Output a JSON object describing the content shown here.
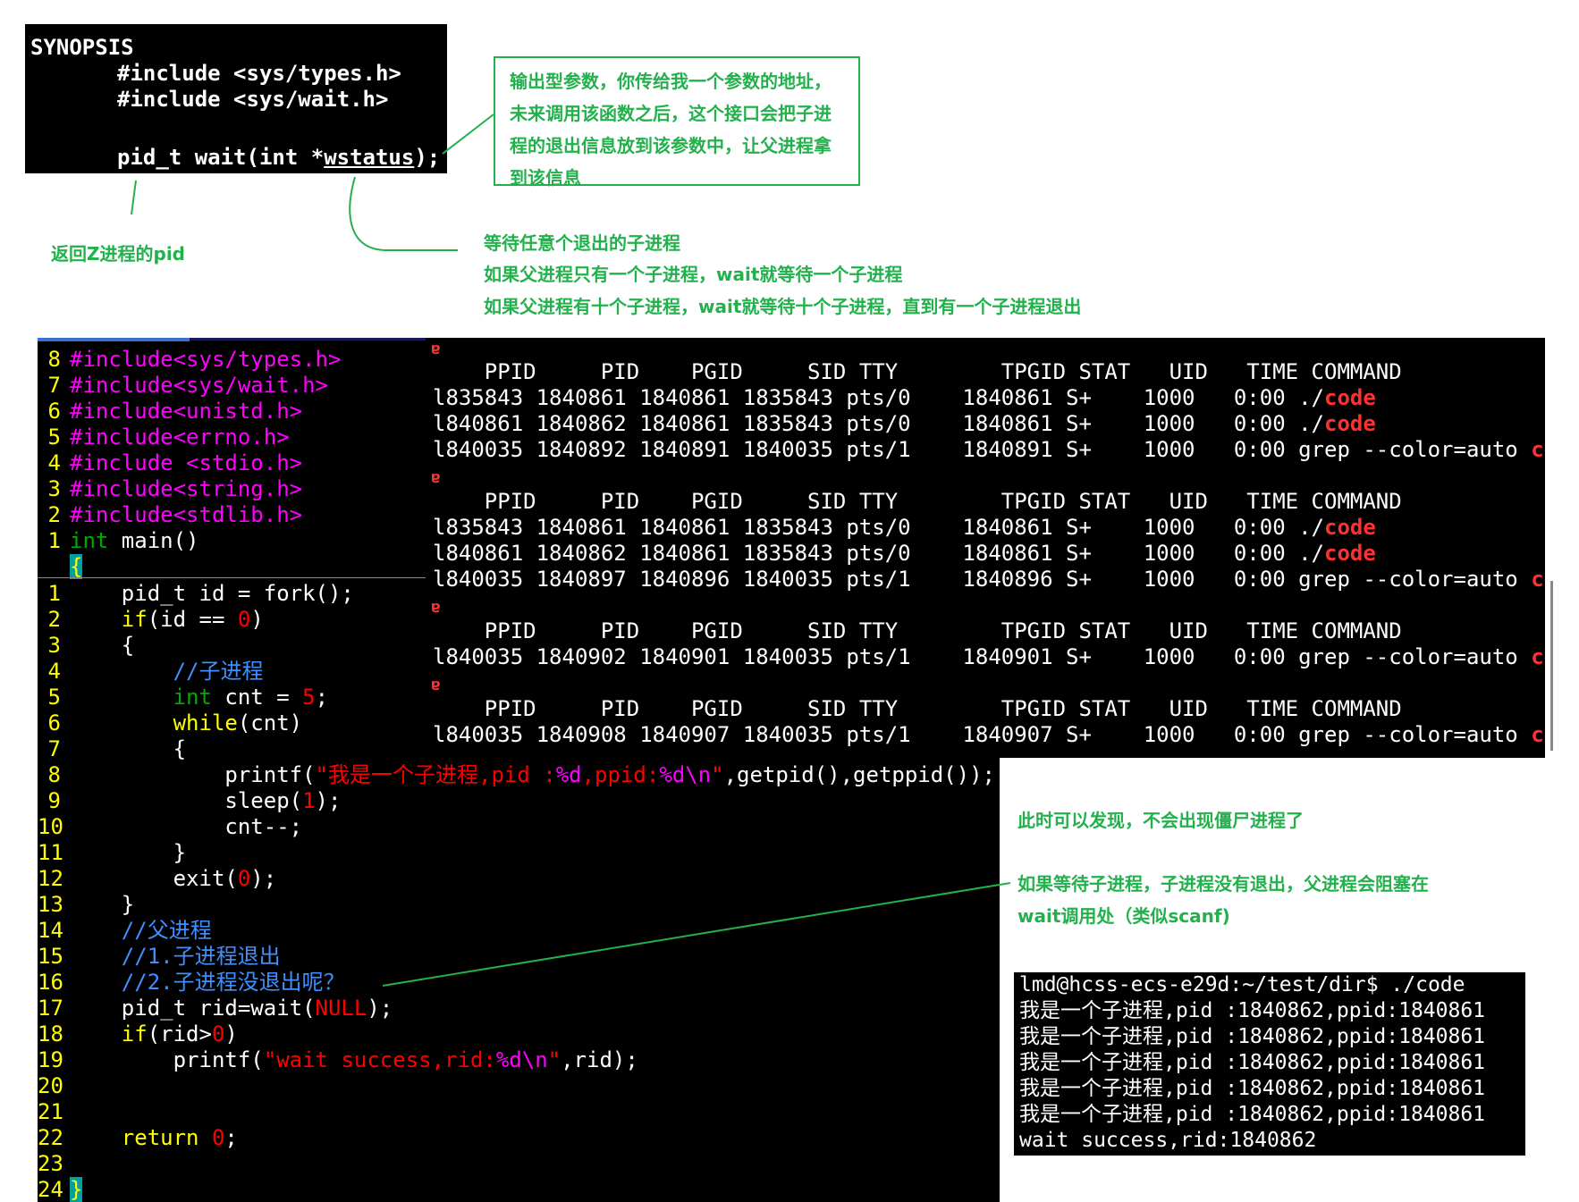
{
  "synopsis": {
    "heading": "SYNOPSIS",
    "include1": "#include <sys/types.h>",
    "include2": "#include <sys/wait.h>",
    "sig_prefix": "pid_t wait(int *",
    "sig_param": "wstatus",
    "sig_suffix": ");"
  },
  "annotations": {
    "output_param": [
      "输出型参数，你传给我一个参数的地址，",
      "未来调用该函数之后，这个接口会把子进",
      "程的退出信息放到该参数中，让父进程拿",
      "到该信息"
    ],
    "return_note": "返回Z进程的pid",
    "wait_any": [
      "等待任意个退出的子进程",
      "如果父进程只有一个子进程，wait就等待一个子进程",
      "如果父进程有十个子进程，wait就等待十个子进程，直到有一个子进程退出"
    ],
    "no_zombie": "此时可以发现，不会出现僵尸进程了",
    "blocking": [
      "如果等待子进程，子进程没有退出，父进程会阻塞在",
      "wait调用处（类似scanf)"
    ]
  },
  "editor": {
    "headers": [
      {
        "ln": "8",
        "text": "#include<sys/types.h>"
      },
      {
        "ln": "7",
        "text": "#include<sys/wait.h>"
      },
      {
        "ln": "6",
        "text": "#include<unistd.h>"
      },
      {
        "ln": "5",
        "text": "#include<errno.h>"
      },
      {
        "ln": "4",
        "text": "#include <stdio.h>"
      },
      {
        "ln": "3",
        "text": "#include<string.h>"
      },
      {
        "ln": "2",
        "text": "#include<stdlib.h>"
      }
    ],
    "main_ln": "1",
    "main_type": "int",
    "main_rest": " main()",
    "open_brace": "{",
    "body_lines": [
      "1",
      "2",
      "3",
      "4",
      "5",
      "6",
      "7",
      "8",
      "9",
      "10",
      "11",
      "12",
      "13",
      "14",
      "15",
      "16",
      "17",
      "18",
      "19",
      "20",
      "21",
      "22",
      "23",
      "24"
    ]
  },
  "ps": {
    "header": "    PPID     PID    PGID     SID TTY        TPGID STAT   UID   TIME COMMAND",
    "blocks": [
      [
        {
          "text": "l835843 1840861 1840861 1835843 pts/0    1840861 S+    1000   0:00 ./",
          "red": "code"
        },
        {
          "text": "l840861 1840862 1840861 1835843 pts/0    1840861 S+    1000   0:00 ./",
          "red": "code"
        },
        {
          "text": "l840035 1840892 1840891 1840035 pts/1    1840891 S+    1000   0:00 grep --color=auto ",
          "red": "cod"
        }
      ],
      [
        {
          "text": "l835843 1840861 1840861 1835843 pts/0    1840861 S+    1000   0:00 ./",
          "red": "code"
        },
        {
          "text": "l840861 1840862 1840861 1835843 pts/0    1840861 S+    1000   0:00 ./",
          "red": "code"
        },
        {
          "text": "l840035 1840897 1840896 1840035 pts/1    1840896 S+    1000   0:00 grep --color=auto ",
          "red": "cod"
        }
      ],
      [
        {
          "text": "l840035 1840902 1840901 1840035 pts/1    1840901 S+    1000   0:00 grep --color=auto ",
          "red": "cod"
        }
      ],
      [
        {
          "text": "l840035 1840908 1840907 1840035 pts/1    1840907 S+    1000   0:00 grep --color=auto ",
          "red": "cod"
        }
      ]
    ]
  },
  "terminal": {
    "lines": [
      "lmd@hcss-ecs-e29d:~/test/dir$ ./code",
      "我是一个子进程,pid :1840862,ppid:1840861",
      "我是一个子进程,pid :1840862,ppid:1840861",
      "我是一个子进程,pid :1840862,ppid:1840861",
      "我是一个子进程,pid :1840862,ppid:1840861",
      "我是一个子进程,pid :1840862,ppid:1840861",
      "wait success,rid:1840862"
    ]
  },
  "colors": {
    "annotation_green": "#22b14c",
    "line_number_yellow": "#ffff00",
    "preprocessor_magenta": "#ff00ff",
    "string_red": "#ff0000",
    "comment_blue": "#3f8fff",
    "type_green": "#00aa00"
  }
}
